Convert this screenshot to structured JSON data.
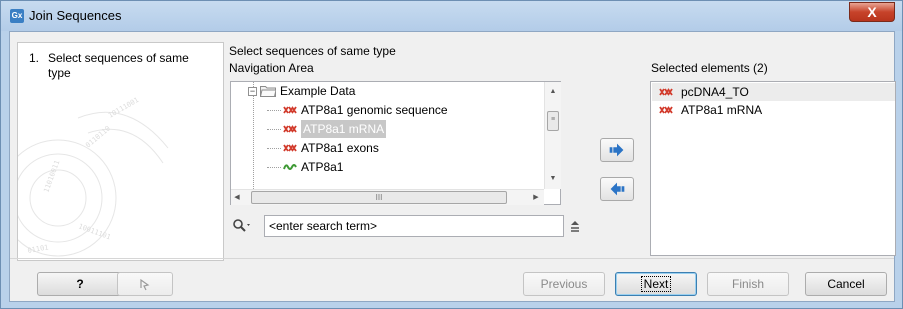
{
  "window": {
    "title": "Join Sequences",
    "app_icon_text": "Gx",
    "close_symbol": "X"
  },
  "steps": [
    {
      "number": "1.",
      "label": "Select sequences of same type"
    }
  ],
  "main": {
    "heading": "Select sequences of same type",
    "navigation_label": "Navigation Area",
    "selected_label": "Selected elements (2)"
  },
  "tree": {
    "folder": {
      "label": "Example Data",
      "expander": "−",
      "icon": "folder-icon"
    },
    "items": [
      {
        "label": "ATP8a1 genomic sequence",
        "icon": "dna-sequence-icon",
        "selected": false
      },
      {
        "label": "ATP8a1 mRNA",
        "icon": "dna-sequence-icon",
        "selected": true
      },
      {
        "label": "ATP8a1 exons",
        "icon": "dna-sequence-icon",
        "selected": false
      },
      {
        "label": "ATP8a1",
        "icon": "protein-sequence-icon",
        "selected": false
      }
    ]
  },
  "search": {
    "placeholder": "",
    "value": "<enter search term>"
  },
  "move_buttons": {
    "add_icon": "arrow-right-icon",
    "remove_icon": "arrow-left-icon"
  },
  "selected_elements": [
    {
      "label": "pcDNA4_TO",
      "icon": "dna-sequence-icon"
    },
    {
      "label": "ATP8a1 mRNA",
      "icon": "dna-sequence-icon"
    }
  ],
  "footer": {
    "help_label": "?",
    "previous_label": "Previous",
    "next_label": "Next",
    "finish_label": "Finish",
    "cancel_label": "Cancel"
  },
  "colors": {
    "dna_icon": "#d23b2c",
    "protein_icon": "#3f9a35",
    "arrow_icon": "#2b74c6",
    "title_bar": "#b9d1ea",
    "close_button": "#c7432a"
  }
}
